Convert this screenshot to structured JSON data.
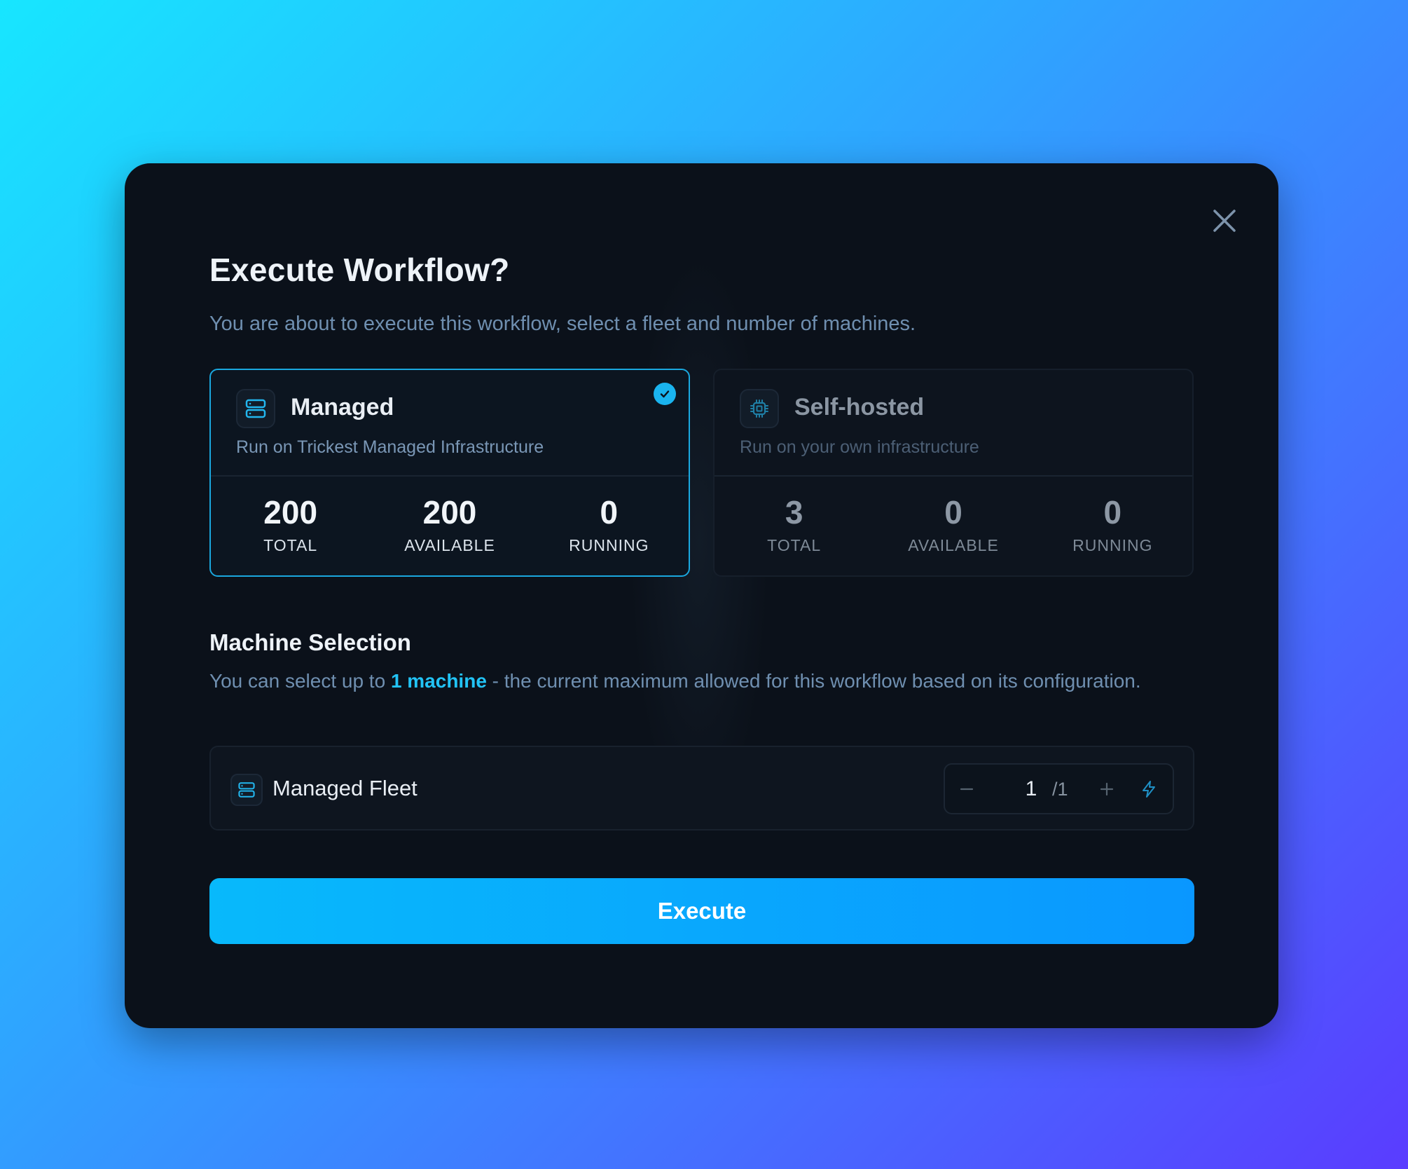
{
  "dialog": {
    "title": "Execute Workflow?",
    "subtitle": "You are about to execute this workflow, select a fleet and number of machines."
  },
  "fleets": [
    {
      "name": "Managed",
      "description": "Run on Trickest Managed Infrastructure",
      "selected": true,
      "icon": "server-icon",
      "stats": [
        {
          "value": "200",
          "label": "TOTAL"
        },
        {
          "value": "200",
          "label": "AVAILABLE"
        },
        {
          "value": "0",
          "label": "RUNNING"
        }
      ]
    },
    {
      "name": "Self-hosted",
      "description": "Run on your own infrastructure",
      "selected": false,
      "icon": "cpu-chip-icon",
      "stats": [
        {
          "value": "3",
          "label": "TOTAL"
        },
        {
          "value": "0",
          "label": "AVAILABLE"
        },
        {
          "value": "0",
          "label": "RUNNING"
        }
      ]
    }
  ],
  "machine_selection": {
    "title": "Machine Selection",
    "desc_prefix": "You can select up to ",
    "desc_highlight": "1 machine",
    "desc_suffix": " - the current maximum allowed for this workflow based on its configuration.",
    "fleet_label": "Managed Fleet",
    "quantity": "1",
    "max": "/1"
  },
  "execute_label": "Execute",
  "colors": {
    "accent": "#1ab4ef",
    "background": "#0b111a",
    "button": "#0a97ff"
  }
}
